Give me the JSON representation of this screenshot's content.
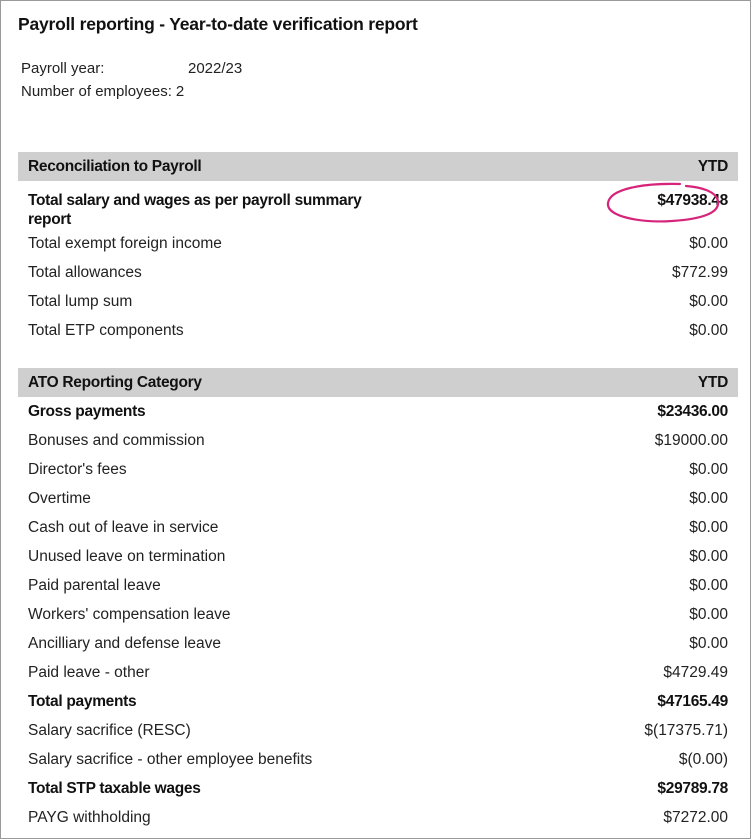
{
  "report": {
    "title": "Payroll reporting - Year-to-date verification report",
    "payroll_year_label": "Payroll year:",
    "payroll_year_value": "2022/23",
    "employees_label": "Number of employees:",
    "employees_value": "2"
  },
  "reconciliation": {
    "header": "Reconciliation to Payroll",
    "column": "YTD",
    "highlight_color": "#d6247a",
    "rows": [
      {
        "label": "Total salary and wages as per payroll summary report",
        "value": "$47938.48",
        "bold": true,
        "highlighted": true
      },
      {
        "label": "Total exempt foreign income",
        "value": "$0.00",
        "bold": false
      },
      {
        "label": "Total allowances",
        "value": "$772.99",
        "bold": false
      },
      {
        "label": "Total lump sum",
        "value": "$0.00",
        "bold": false
      },
      {
        "label": "Total ETP components",
        "value": "$0.00",
        "bold": false
      }
    ]
  },
  "ato": {
    "header": "ATO Reporting Category",
    "column": "YTD",
    "rows": [
      {
        "label": "Gross payments",
        "value": "$23436.00",
        "bold": true
      },
      {
        "label": "Bonuses and commission",
        "value": "$19000.00",
        "bold": false
      },
      {
        "label": "Director's fees",
        "value": "$0.00",
        "bold": false
      },
      {
        "label": "Overtime",
        "value": "$0.00",
        "bold": false
      },
      {
        "label": "Cash out of leave in service",
        "value": "$0.00",
        "bold": false
      },
      {
        "label": "Unused leave on termination",
        "value": "$0.00",
        "bold": false
      },
      {
        "label": "Paid parental leave",
        "value": "$0.00",
        "bold": false
      },
      {
        "label": "Workers' compensation leave",
        "value": "$0.00",
        "bold": false
      },
      {
        "label": "Ancilliary and defense leave",
        "value": "$0.00",
        "bold": false
      },
      {
        "label": "Paid leave - other",
        "value": "$4729.49",
        "bold": false
      },
      {
        "label": "Total payments",
        "value": "$47165.49",
        "bold": true
      },
      {
        "label": "Salary sacrifice (RESC)",
        "value": "$(17375.71)",
        "bold": false
      },
      {
        "label": "Salary sacrifice - other employee benefits",
        "value": "$(0.00)",
        "bold": false
      },
      {
        "label": "Total STP taxable wages",
        "value": "$29789.78",
        "bold": true
      },
      {
        "label": "PAYG withholding",
        "value": "$7272.00",
        "bold": false
      }
    ]
  }
}
